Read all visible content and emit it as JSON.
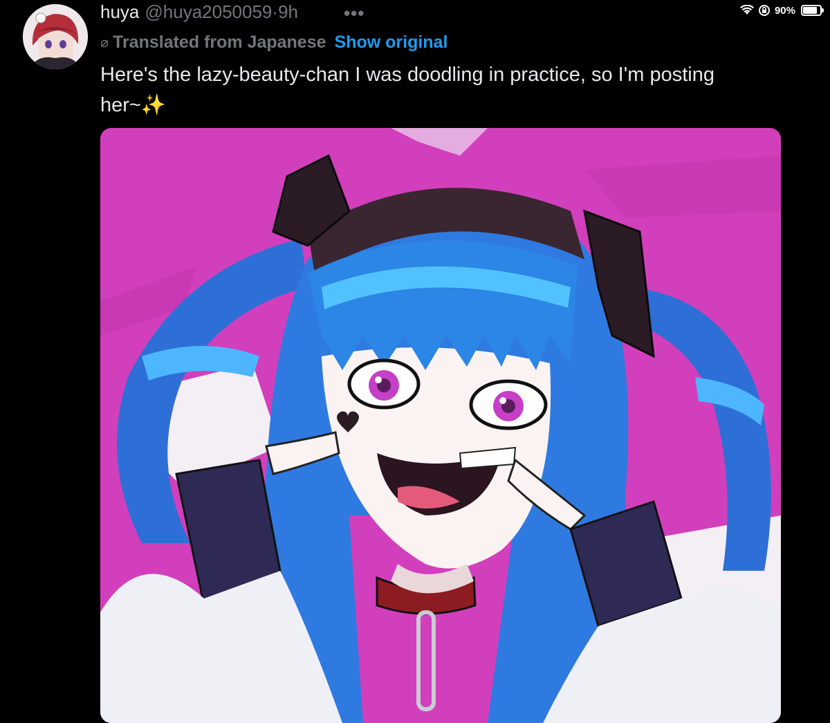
{
  "status_bar": {
    "battery": "90%",
    "battery_level": 0.9
  },
  "tweet": {
    "display_name": "huya",
    "handle": "@huya2050059",
    "separator": "·",
    "time": "9h",
    "more_label": "•••",
    "translation_notice": "Translated from Japanese",
    "show_original_label": "Show original",
    "text": "Here's the lazy-beauty-chan I was doodling in practice, so I'm posting her~✨"
  },
  "icons": {
    "wifi": "wifi-icon",
    "lock": "orientation-lock-icon",
    "globe": "translate-globe-icon",
    "more": "more-options-icon"
  },
  "colors": {
    "background": "#000000",
    "link": "#1d9bf0",
    "secondary": "#71767b",
    "media_bg": "#d23fbc"
  }
}
